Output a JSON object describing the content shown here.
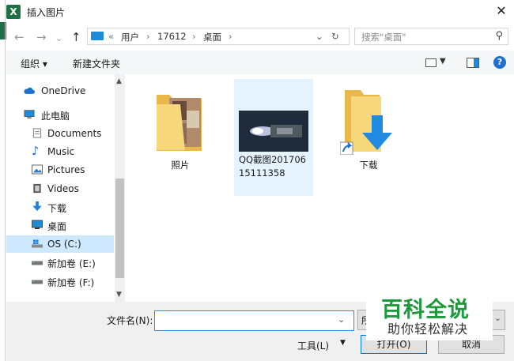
{
  "window": {
    "title": "插入图片",
    "app_icon_letter": "X"
  },
  "address": {
    "crumbs": [
      "«",
      "用户",
      "17612",
      "桌面"
    ]
  },
  "search": {
    "placeholder": "搜索\"桌面\""
  },
  "toolbar": {
    "organize": "组织 ▾",
    "new_folder": "新建文件夹"
  },
  "nav_items": [
    {
      "label": "OneDrive"
    },
    {
      "label": "此电脑"
    },
    {
      "label": "Documents"
    },
    {
      "label": "Music"
    },
    {
      "label": "Pictures"
    },
    {
      "label": "Videos"
    },
    {
      "label": "下载"
    },
    {
      "label": "桌面"
    },
    {
      "label": "OS (C:)"
    },
    {
      "label": "新加卷 (E:)"
    },
    {
      "label": "新加卷 (F:)"
    }
  ],
  "files": [
    {
      "label": "照片"
    },
    {
      "label": "QQ截图20170615111358"
    },
    {
      "label": "下载"
    }
  ],
  "bottom": {
    "filename_label": "文件名(N):",
    "filename_value": "",
    "filter_value": "所",
    "tools_label": "工具(L)",
    "open_label": "打开(O)",
    "cancel_label": "取消"
  },
  "watermark": {
    "line1": "百科全说",
    "line2": "助你轻松解决"
  },
  "colors": {
    "accent": "#1f8ad8",
    "selected": "#cde8ff",
    "excel_green": "#1e7145",
    "watermark_green": "#1e9a3c"
  }
}
